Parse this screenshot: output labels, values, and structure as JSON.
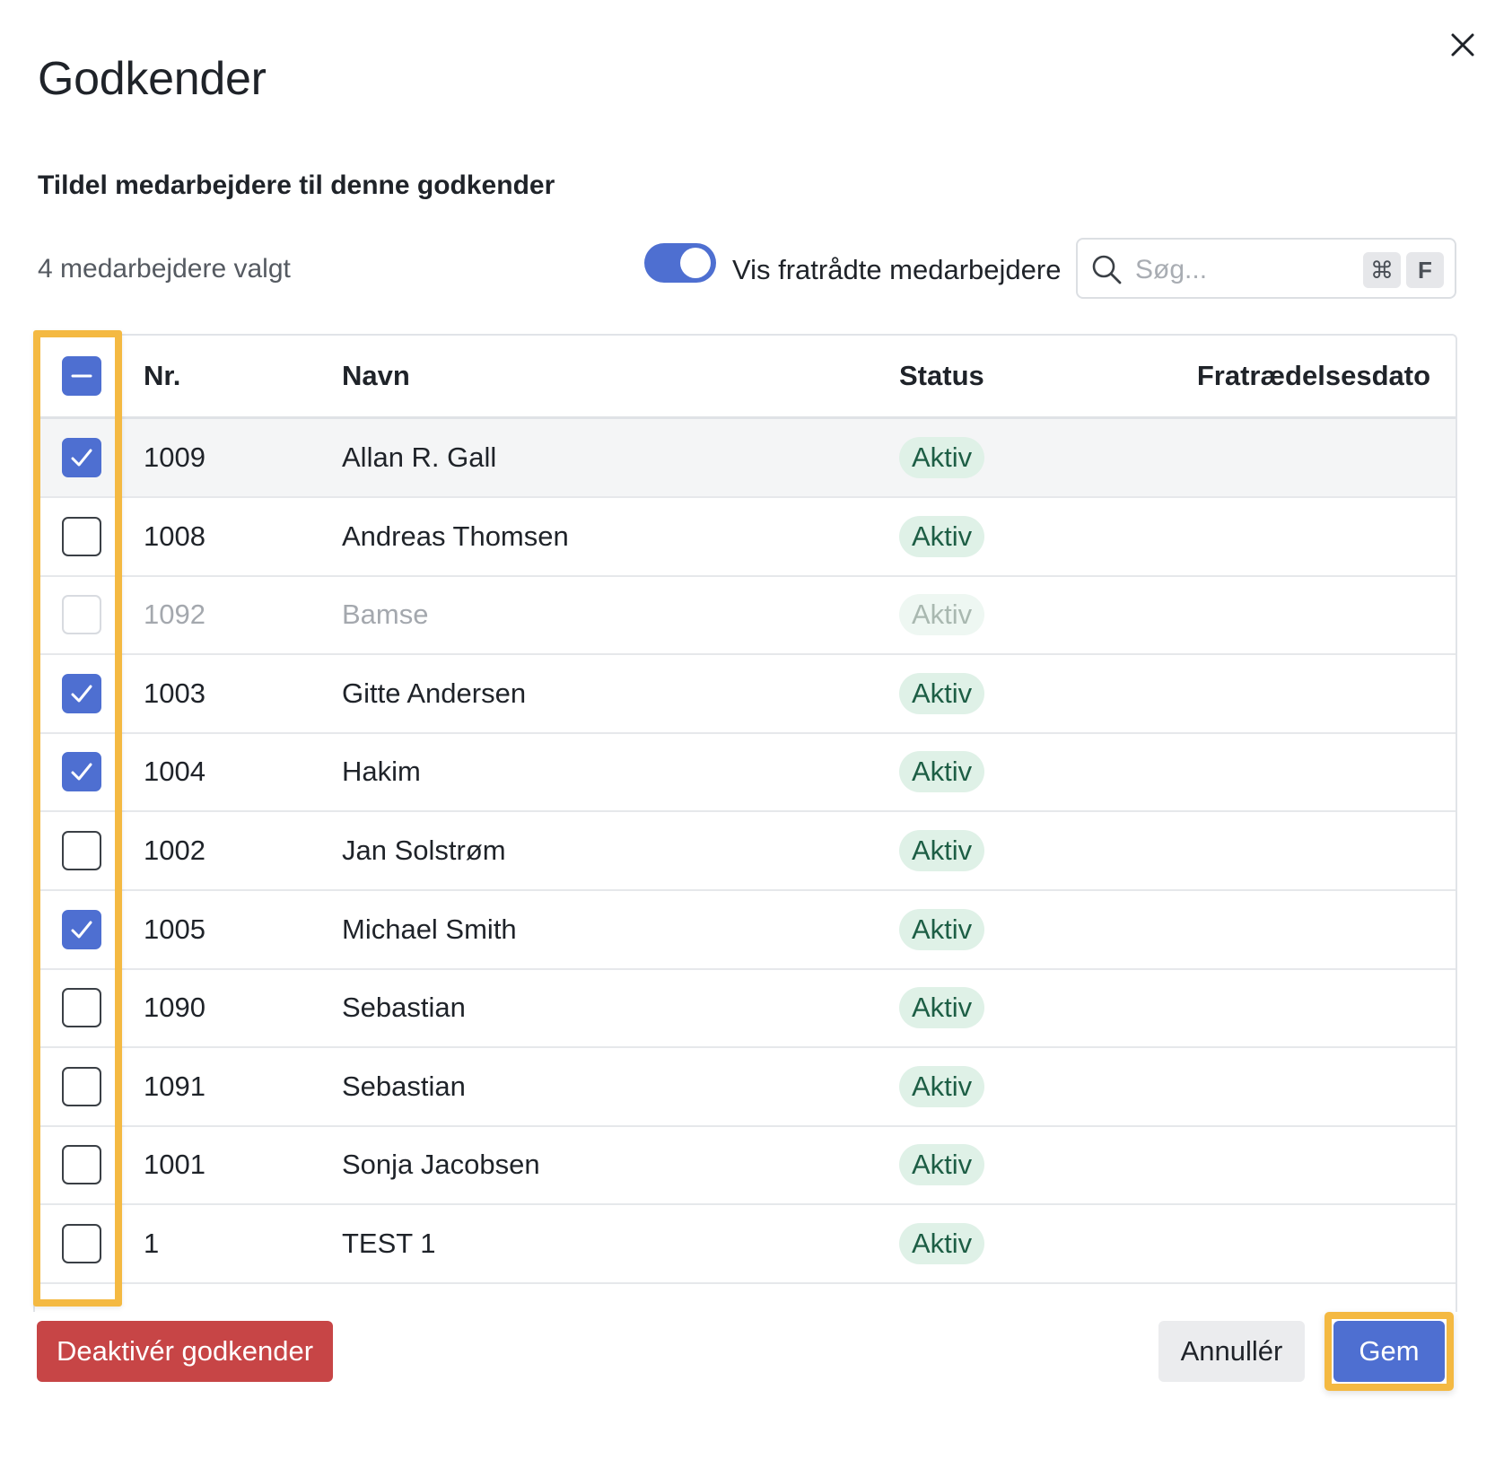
{
  "dialog": {
    "title": "Godkender",
    "subtitle": "Tildel medarbejdere til denne godkender",
    "close_icon": "close-icon"
  },
  "toolbar": {
    "selected_count": "4 medarbejdere valgt",
    "toggle_label": "Vis fratrådte medarbejdere",
    "toggle_on": true,
    "search_placeholder": "Søg...",
    "search_value": "",
    "shortcut_cmd": "⌘",
    "shortcut_key": "F"
  },
  "table": {
    "headers": {
      "nr": "Nr.",
      "name": "Navn",
      "status": "Status",
      "date": "Fratrædelsesdato"
    },
    "select_all_state": "indeterminate",
    "rows": [
      {
        "nr": "1009",
        "name": "Allan R. Gall",
        "status": "Aktiv",
        "date": "",
        "checked": true,
        "disabled": false
      },
      {
        "nr": "1008",
        "name": "Andreas Thomsen",
        "status": "Aktiv",
        "date": "",
        "checked": false,
        "disabled": false
      },
      {
        "nr": "1092",
        "name": "Bamse",
        "status": "Aktiv",
        "date": "",
        "checked": false,
        "disabled": true
      },
      {
        "nr": "1003",
        "name": "Gitte Andersen",
        "status": "Aktiv",
        "date": "",
        "checked": true,
        "disabled": false
      },
      {
        "nr": "1004",
        "name": "Hakim",
        "status": "Aktiv",
        "date": "",
        "checked": true,
        "disabled": false
      },
      {
        "nr": "1002",
        "name": "Jan Solstrøm",
        "status": "Aktiv",
        "date": "",
        "checked": false,
        "disabled": false
      },
      {
        "nr": "1005",
        "name": "Michael Smith",
        "status": "Aktiv",
        "date": "",
        "checked": true,
        "disabled": false
      },
      {
        "nr": "1090",
        "name": "Sebastian",
        "status": "Aktiv",
        "date": "",
        "checked": false,
        "disabled": false
      },
      {
        "nr": "1091",
        "name": "Sebastian",
        "status": "Aktiv",
        "date": "",
        "checked": false,
        "disabled": false
      },
      {
        "nr": "1001",
        "name": "Sonja Jacobsen",
        "status": "Aktiv",
        "date": "",
        "checked": false,
        "disabled": false
      },
      {
        "nr": "1",
        "name": "TEST 1",
        "status": "Aktiv",
        "date": "",
        "checked": false,
        "disabled": false
      }
    ]
  },
  "footer": {
    "deactivate_label": "Deaktivér godkender",
    "cancel_label": "Annullér",
    "save_label": "Gem"
  },
  "colors": {
    "primary": "#4e6fd1",
    "danger": "#c74546",
    "highlight": "#f4b942",
    "badge_bg": "#dff1e7"
  }
}
